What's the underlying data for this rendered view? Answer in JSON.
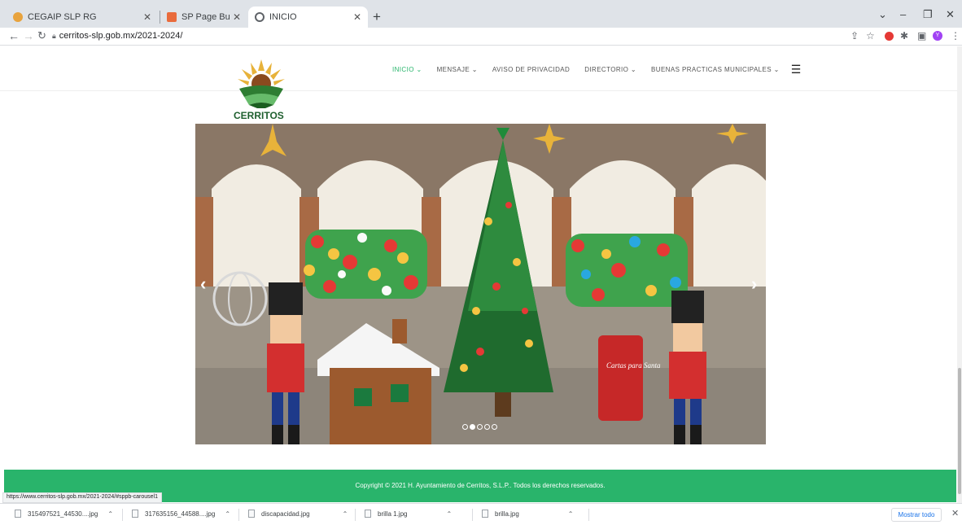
{
  "browser": {
    "tabs": [
      {
        "title": "CEGAIP SLP RG",
        "icon_color": "#e8a33d"
      },
      {
        "title": "SP Page Builder - Edit Page - H...",
        "icon_color": "#e96b3c"
      },
      {
        "title": "INICIO",
        "icon_color": "#5f6368"
      }
    ],
    "address": "cerritos-slp.gob.mx/2021-2024/",
    "status_url": "https://www.cerritos-slp.gob.mx/2021-2024/#sppb-carousel1"
  },
  "site": {
    "logo_text": "CERRITOS",
    "nav": [
      {
        "label": "INICIO ⌄"
      },
      {
        "label": "MENSAJE ⌄"
      },
      {
        "label": "AVISO DE PRIVACIDAD"
      },
      {
        "label": "DIRECTORIO ⌄"
      },
      {
        "label": "BUENAS PRACTICAS MUNICIPALES ⌄"
      }
    ],
    "carousel": {
      "slides": 5,
      "active": 2
    },
    "footer": "Copyright © 2021 H. Ayuntamiento de Cerritos, S.L.P.. Todos los derechos reservados.",
    "sign_text": "Cartas para Santa"
  },
  "downloads": {
    "items": [
      {
        "name": "315497521_44530....jpg"
      },
      {
        "name": "317635156_44588....jpg"
      },
      {
        "name": "discapacidad.jpg"
      },
      {
        "name": "brilla 1.jpg"
      },
      {
        "name": "brilla.jpg"
      }
    ],
    "show_all": "Mostrar todo"
  },
  "colors": {
    "brand_green": "#29b46b",
    "nav_active": "#27b56b"
  }
}
